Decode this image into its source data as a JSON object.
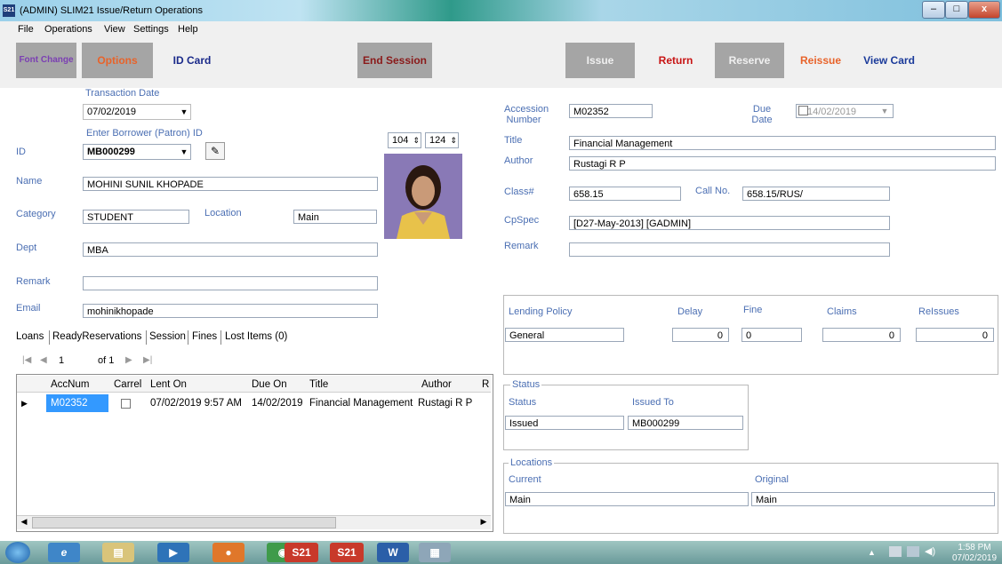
{
  "window": {
    "title": "(ADMIN) SLIM21 Issue/Return Operations",
    "app_icon": "S21",
    "controls": {
      "minimize": "–",
      "maximize": "□",
      "close": "x"
    }
  },
  "menu": [
    "File",
    "Operations",
    "View",
    "Settings",
    "Help"
  ],
  "toolbar": {
    "font_change": "Font Change",
    "options": "Options",
    "id_card": "ID Card",
    "end_session": "End Session",
    "issue": "Issue",
    "return": "Return",
    "reserve": "Reserve",
    "reissue": "Reissue",
    "view_card": "View Card"
  },
  "colors": {
    "label": "#4b6fb3",
    "font_change": "#7b3fb3",
    "options": "#e8632a",
    "id_card": "#1a2a8a",
    "end_session": "#8a1a1a",
    "return": "#c81414",
    "reissue": "#e8632a",
    "view_card": "#1a3a9a",
    "disabled": "#f0f0f0",
    "selected_cell": "#3399ff"
  },
  "patron": {
    "transaction_date_label": "Transaction Date",
    "transaction_date": "07/02/2019",
    "borrower_label": "Enter Borrower (Patron) ID",
    "id_label": "ID",
    "id_value": "MB000299",
    "photo_w": "104",
    "photo_h": "124",
    "name_label": "Name",
    "name_value": "MOHINI SUNIL KHOPADE",
    "category_label": "Category",
    "category_value": "STUDENT",
    "location_label": "Location",
    "location_value": "Main",
    "dept_label": "Dept",
    "dept_value": "MBA",
    "remark_label": "Remark",
    "remark_value": "",
    "email_label": "Email",
    "email_value": "mohinikhopade"
  },
  "tabs": [
    "Loans",
    "ReadyReservations",
    "Session",
    "Fines",
    "Lost Items (0)"
  ],
  "pager": {
    "current": "1",
    "of_label": "of 1"
  },
  "grid": {
    "columns": [
      "AccNum",
      "Carrel",
      "Lent On",
      "Due On",
      "Title",
      "Author",
      "R"
    ],
    "rows": [
      {
        "accnum": "M02352",
        "carrel": "",
        "lent_on": "07/02/2019 9:57 AM",
        "due_on": "14/02/2019",
        "title": "Financial Management",
        "author": "Rustagi R P"
      }
    ]
  },
  "book": {
    "accession_label": "Accession Number",
    "accession_value": "M02352",
    "due_label": "Due Date",
    "due_value": "14/02/2019",
    "title_label": "Title",
    "title_value": "Financial Management",
    "author_label": "Author",
    "author_value": "Rustagi R P",
    "class_label": "Class#",
    "class_value": "658.15",
    "callno_label": "Call No.",
    "callno_value": "658.15/RUS/",
    "cpspec_label": "CpSpec",
    "cpspec_value": "[D27-May-2013] [GADMIN]",
    "remark_label": "Remark",
    "remark_value": ""
  },
  "policy": {
    "lending_label": "Lending Policy",
    "lending_value": "General",
    "delay_label": "Delay",
    "delay_value": "0",
    "fine_label": "Fine",
    "fine_value": "0",
    "claims_label": "Claims",
    "claims_value": "0",
    "reissues_label": "ReIssues",
    "reissues_value": "0"
  },
  "status": {
    "group_title": "Status",
    "status_label": "Status",
    "status_value": "Issued",
    "issued_to_label": "Issued To",
    "issued_to_value": "MB000299"
  },
  "locations": {
    "group_title": "Locations",
    "current_label": "Current",
    "current_value": "Main",
    "original_label": "Original",
    "original_value": "Main"
  },
  "taskbar": {
    "time": "1:58 PM",
    "date": "07/02/2019",
    "apps": [
      "start-orb-icon",
      "ie-icon",
      "explorer-icon",
      "media-player-icon",
      "firefox-icon",
      "chrome-icon",
      "slim21-icon",
      "slim21-icon",
      "word-icon",
      "calculator-icon"
    ]
  }
}
